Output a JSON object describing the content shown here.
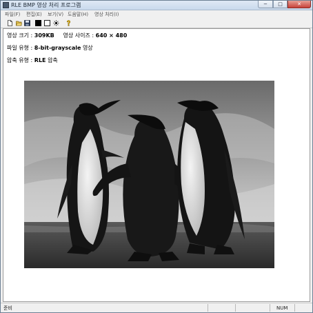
{
  "window": {
    "title": "RLE BMP 영상 처리 프로그램"
  },
  "caption_buttons": {
    "minimize": "−",
    "maximize": "□",
    "close": "✕"
  },
  "menu": [
    {
      "label": "파일(F)"
    },
    {
      "label": "편집(E)"
    },
    {
      "label": "보기(V)"
    },
    {
      "label": "도움말(H)"
    },
    {
      "label": "영상 처리(I)"
    }
  ],
  "toolbar": {
    "icons": [
      "new-file-icon",
      "open-folder-icon",
      "save-disk-icon",
      "black-square-icon",
      "white-square-icon",
      "sun-icon",
      "help-icon"
    ]
  },
  "info": {
    "size_label": "영상 크기 :",
    "size_value": "309KB",
    "dims_label": "영상 사이즈 :",
    "dims_value": "640 × 480",
    "type_label": "파일 유형 :",
    "type_value": "8-bit-grayscale",
    "type_suffix": "영상",
    "comp_label": "압축 유형 :",
    "comp_value": "RLE",
    "comp_suffix": "압축"
  },
  "status": {
    "text": "준비",
    "num": "NUM"
  }
}
